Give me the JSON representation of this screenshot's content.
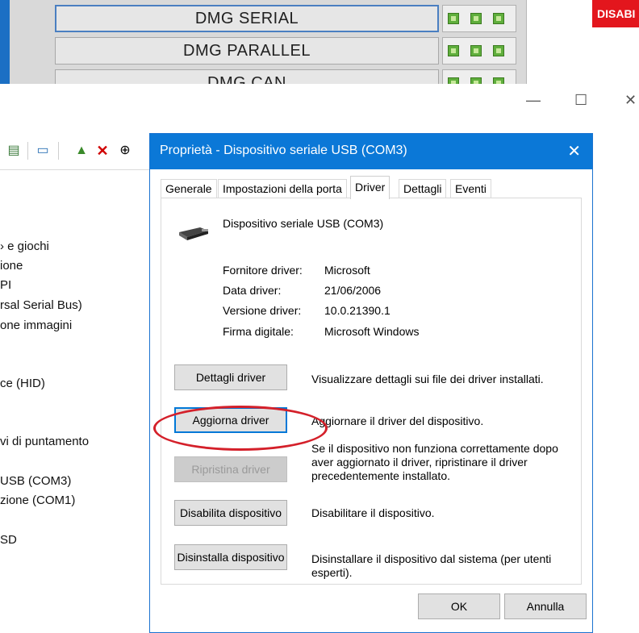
{
  "background_app": {
    "buttons": [
      {
        "label": "DMG SERIAL",
        "selected": true
      },
      {
        "label": "DMG PARALLEL",
        "selected": false
      },
      {
        "label": "DMG CAN",
        "selected": false
      }
    ],
    "status_badge": "DISABI",
    "badge_color": "#e3161d"
  },
  "window_controls": {
    "minimize": "—",
    "maximize": "☐",
    "close": "✕"
  },
  "device_manager": {
    "tree": [
      "› e giochi",
      "ione",
      "PI",
      "rsal Serial Bus)",
      "one immagini",
      "ce (HID)",
      "vi di puntamento",
      " USB (COM3)",
      "zione (COM1)",
      "SD"
    ]
  },
  "dialog": {
    "title": "Proprietà - Dispositivo seriale USB (COM3)",
    "close": "✕",
    "tabs": [
      "Generale",
      "Impostazioni della porta",
      "Driver",
      "Dettagli",
      "Eventi"
    ],
    "active_tab": "Driver",
    "device_name": "Dispositivo seriale USB (COM3)",
    "properties": [
      {
        "label": "Fornitore driver:",
        "value": "Microsoft"
      },
      {
        "label": "Data driver:",
        "value": "21/06/2006"
      },
      {
        "label": "Versione driver:",
        "value": "10.0.21390.1"
      },
      {
        "label": "Firma digitale:",
        "value": "Microsoft Windows"
      }
    ],
    "actions": [
      {
        "button": "Dettagli driver",
        "description": "Visualizzare dettagli sui file dei driver installati."
      },
      {
        "button": "Aggiorna driver",
        "description": "Aggiornare il driver del dispositivo."
      },
      {
        "button": "Ripristina driver",
        "description": "Se il dispositivo non funziona correttamente dopo aver aggiornato il driver, ripristinare il driver precedentemente installato."
      },
      {
        "button": "Disabilita dispositivo",
        "description": "Disabilitare il dispositivo."
      },
      {
        "button": "Disinstalla dispositivo",
        "description": "Disinstallare il dispositivo dal sistema (per utenti esperti)."
      }
    ],
    "ok": "OK",
    "cancel": "Annulla",
    "accent_color": "#0b78d7",
    "highlight_color": "#d4202a"
  }
}
